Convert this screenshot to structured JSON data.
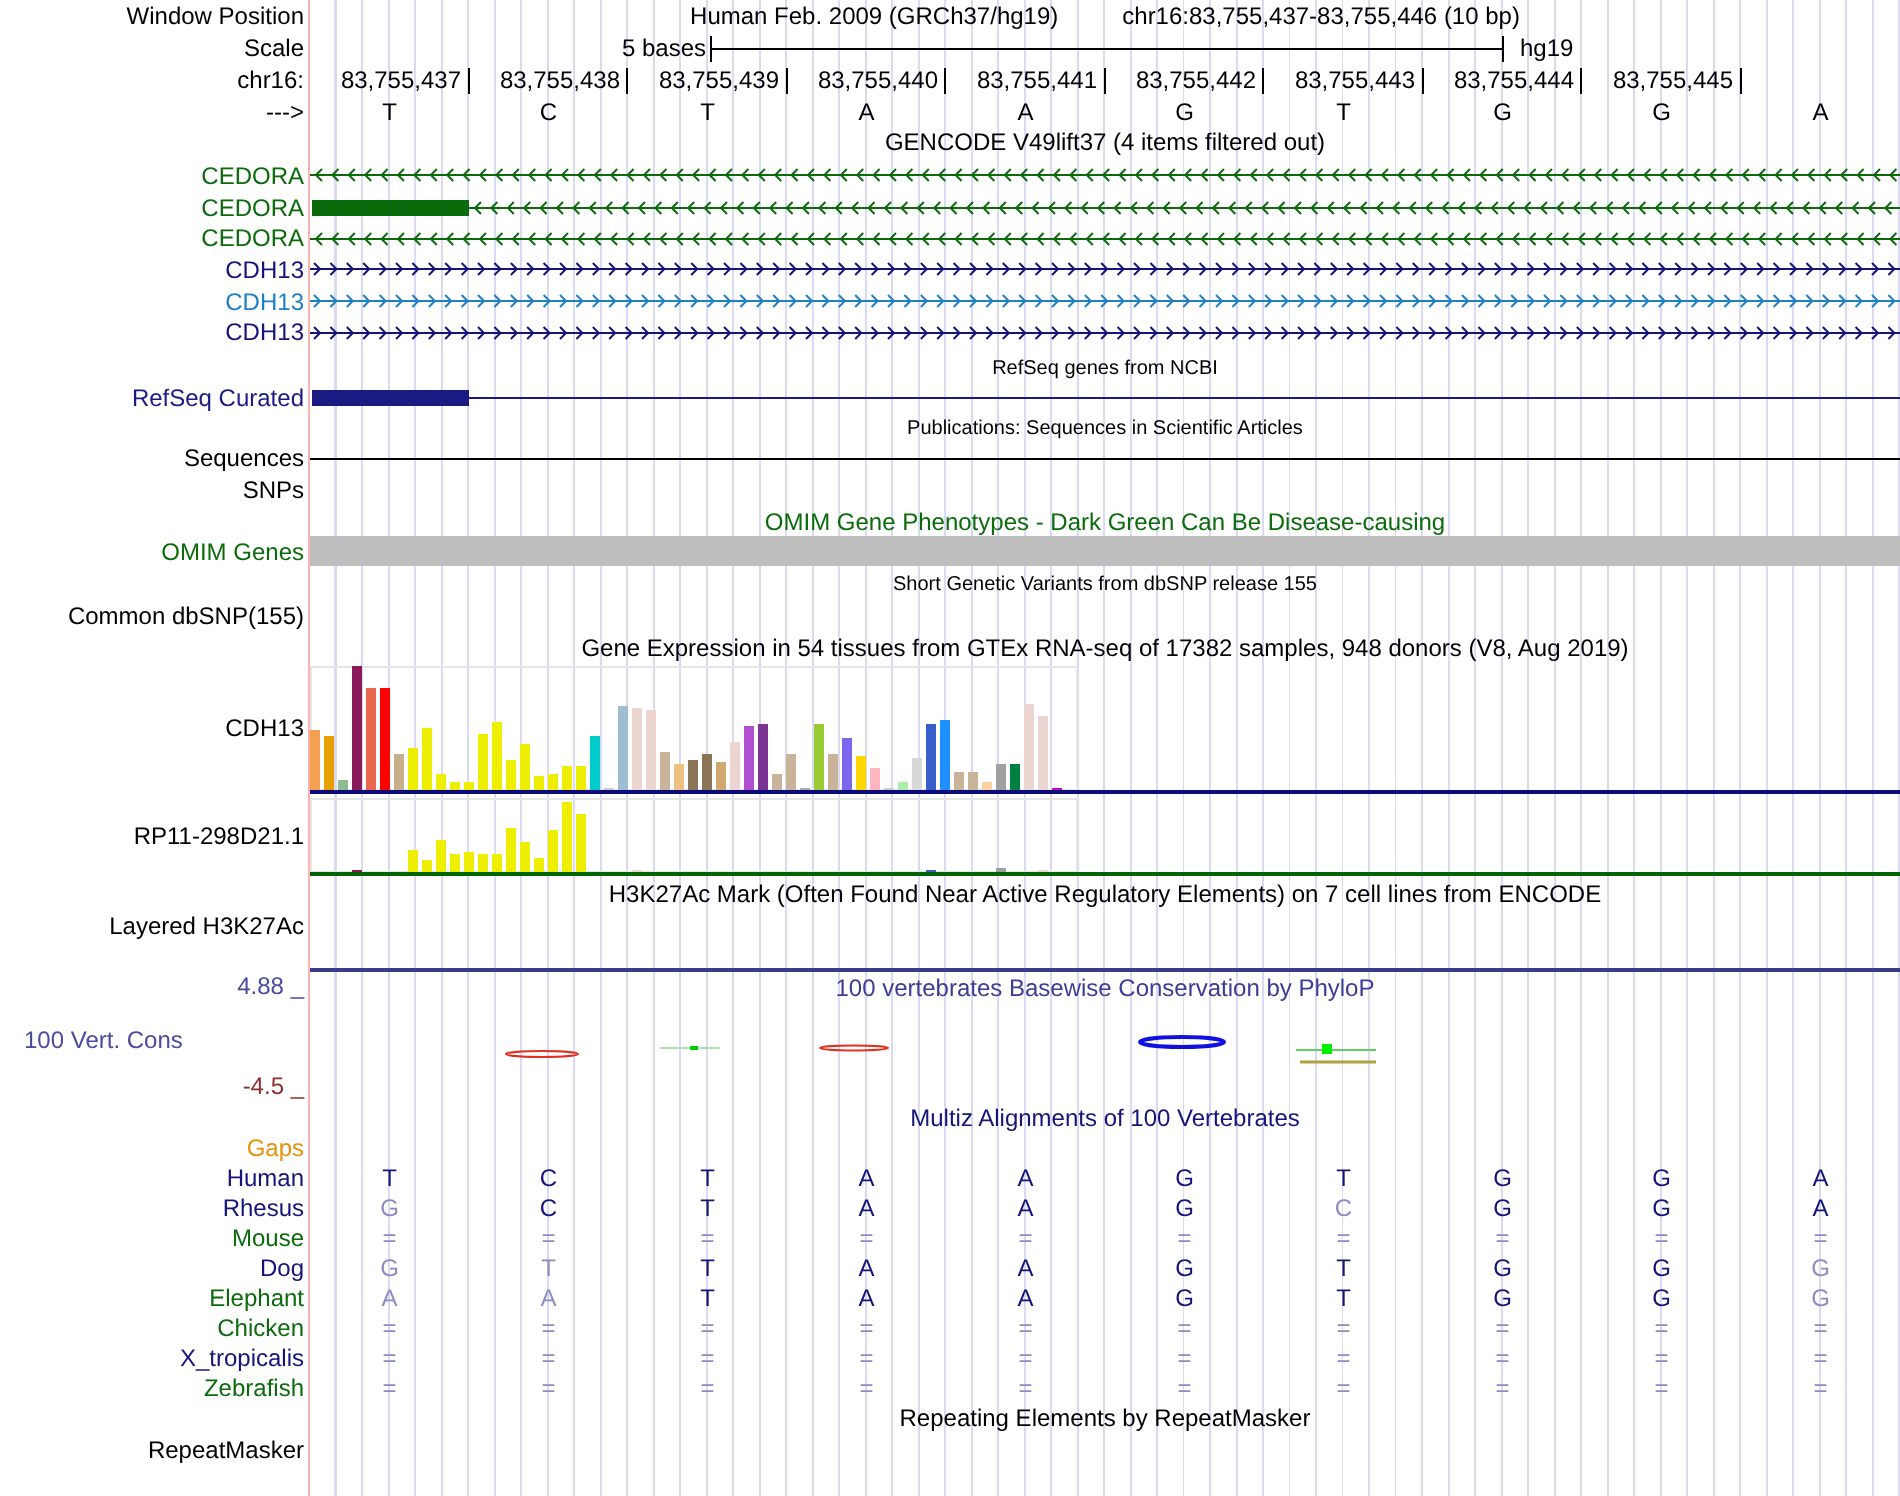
{
  "position": {
    "label": "Window Position",
    "assembly": "Human Feb. 2009 (GRCh37/hg19)",
    "range": "chr16:83,755,437-83,755,446 (10 bp)"
  },
  "scale": {
    "label": "Scale",
    "length": "5 bases",
    "assembly": "hg19"
  },
  "coordinates": {
    "label": "chr16:",
    "ticks": [
      "83,755,437",
      "83,755,438",
      "83,755,439",
      "83,755,440",
      "83,755,441",
      "83,755,442",
      "83,755,443",
      "83,755,444",
      "83,755,445"
    ]
  },
  "sequence": {
    "label": "--->",
    "bases": [
      "T",
      "C",
      "T",
      "A",
      "A",
      "G",
      "T",
      "G",
      "G",
      "A"
    ]
  },
  "tracks": [
    {
      "kind": "annotation",
      "title": "GENCODE V49lift37 (4 items filtered out)",
      "color": "#000000",
      "items": [
        {
          "kind": "gene",
          "name": "CEDORA",
          "color": "#0b6b0b",
          "strand_marks": true,
          "reverse_strand": true,
          "exon": false
        },
        {
          "kind": "gene",
          "name": "CEDORA",
          "color": "#0b6b0b",
          "strand_marks": true,
          "reverse_strand": true,
          "exon": true
        },
        {
          "kind": "gene",
          "name": "CEDORA",
          "color": "#0b6b0b",
          "strand_marks": true,
          "reverse_strand": true,
          "exon": false
        },
        {
          "kind": "gene",
          "name": "CDH13",
          "color": "#14147a",
          "strand_marks": true,
          "reverse_strand": false,
          "exon": false
        },
        {
          "kind": "gene",
          "name": "CDH13",
          "color": "#1f7fc4",
          "strand_marks": true,
          "reverse_strand": false,
          "exon": false
        },
        {
          "kind": "gene",
          "name": "CDH13",
          "color": "#14147a",
          "strand_marks": true,
          "reverse_strand": false,
          "exon": false
        }
      ]
    },
    {
      "kind": "annotation",
      "title": "RefSeq genes from NCBI",
      "color": "#000000",
      "items": [
        {
          "kind": "gene",
          "name": "RefSeq Curated",
          "color": "#1a1a82",
          "strand_marks": false,
          "exon": true
        }
      ]
    },
    {
      "kind": "annotation",
      "title": "Publications: Sequences in Scientific Articles",
      "color": "#000000",
      "items": [
        {
          "kind": "gene",
          "name": "Sequences",
          "color": "#000000",
          "strand_marks": false,
          "exon": false
        },
        {
          "kind": "empty",
          "name": "SNPs",
          "color": "#000000"
        }
      ]
    },
    {
      "kind": "annotation",
      "title": "OMIM Gene Phenotypes - Dark Green Can Be Disease-causing",
      "color": "#0b6b0b",
      "items": [
        {
          "kind": "block",
          "name": "OMIM Genes",
          "color": "#0b6b0b"
        }
      ]
    },
    {
      "kind": "annotation",
      "title": "Short Genetic Variants from dbSNP release 155",
      "color": "#000000",
      "items": [
        {
          "kind": "empty",
          "name": "Common dbSNP(155)",
          "color": "#000000"
        }
      ]
    },
    {
      "kind": "annotation",
      "title": "Gene Expression in 54 tissues from GTEx RNA-seq of 17382 samples, 948 donors (V8, Aug 2019)",
      "color": "#000000",
      "items": [
        {
          "kind": "expression",
          "name": "CDH13",
          "color": "#000000"
        },
        {
          "kind": "expression",
          "name": "RP11-298D21.1",
          "color": "#000000"
        }
      ]
    },
    {
      "kind": "annotation",
      "title": "H3K27Ac Mark (Often Found Near Active Regulatory Elements) on 7 cell lines from ENCODE",
      "color": "#000000",
      "items": [
        {
          "kind": "signal",
          "name": "Layered H3K27Ac",
          "color": "#000000"
        }
      ]
    },
    {
      "kind": "wiggle",
      "title": "100 vertebrates Basewise Conservation by PhyloP",
      "color": "#3c3c96",
      "label": "100 Vert. Cons",
      "max": "4.88 _",
      "min": "-4.5 _"
    },
    {
      "kind": "annotation",
      "title": "Multiz Alignments of 100 Vertebrates",
      "color": "#14147a",
      "items": [
        {
          "kind": "empty",
          "name": "Gaps",
          "color": "#e8900a"
        },
        {
          "kind": "bases",
          "name": "Human",
          "color": "#14147a",
          "bases": [
            {
              "text": "T",
              "conserved": true
            },
            {
              "text": "C",
              "conserved": true
            },
            {
              "text": "T",
              "conserved": true
            },
            {
              "text": "A",
              "conserved": true
            },
            {
              "text": "A",
              "conserved": true
            },
            {
              "text": "G",
              "conserved": true
            },
            {
              "text": "T",
              "conserved": true
            },
            {
              "text": "G",
              "conserved": true
            },
            {
              "text": "G",
              "conserved": true
            },
            {
              "text": "A",
              "conserved": true
            }
          ]
        },
        {
          "kind": "bases",
          "name": "Rhesus",
          "color": "#14147a",
          "bases": [
            {
              "text": "G",
              "conserved": false
            },
            {
              "text": "C",
              "conserved": true
            },
            {
              "text": "T",
              "conserved": true
            },
            {
              "text": "A",
              "conserved": true
            },
            {
              "text": "A",
              "conserved": true
            },
            {
              "text": "G",
              "conserved": true
            },
            {
              "text": "C",
              "conserved": false
            },
            {
              "text": "G",
              "conserved": true
            },
            {
              "text": "G",
              "conserved": true
            },
            {
              "text": "A",
              "conserved": true
            }
          ]
        },
        {
          "kind": "bases",
          "name": "Mouse",
          "color": "#0b6b0b",
          "bases": [
            {
              "text": "=",
              "conserved": false
            },
            {
              "text": "=",
              "conserved": false
            },
            {
              "text": "=",
              "conserved": false
            },
            {
              "text": "=",
              "conserved": false
            },
            {
              "text": "=",
              "conserved": false
            },
            {
              "text": "=",
              "conserved": false
            },
            {
              "text": "=",
              "conserved": false
            },
            {
              "text": "=",
              "conserved": false
            },
            {
              "text": "=",
              "conserved": false
            },
            {
              "text": "=",
              "conserved": false
            }
          ]
        },
        {
          "kind": "bases",
          "name": "Dog",
          "color": "#14147a",
          "bases": [
            {
              "text": "G",
              "conserved": false
            },
            {
              "text": "T",
              "conserved": false
            },
            {
              "text": "T",
              "conserved": true
            },
            {
              "text": "A",
              "conserved": true
            },
            {
              "text": "A",
              "conserved": true
            },
            {
              "text": "G",
              "conserved": true
            },
            {
              "text": "T",
              "conserved": true
            },
            {
              "text": "G",
              "conserved": true
            },
            {
              "text": "G",
              "conserved": true
            },
            {
              "text": "G",
              "conserved": false
            }
          ]
        },
        {
          "kind": "bases",
          "name": "Elephant",
          "color": "#0b6b0b",
          "bases": [
            {
              "text": "A",
              "conserved": false
            },
            {
              "text": "A",
              "conserved": false
            },
            {
              "text": "T",
              "conserved": true
            },
            {
              "text": "A",
              "conserved": true
            },
            {
              "text": "A",
              "conserved": true
            },
            {
              "text": "G",
              "conserved": true
            },
            {
              "text": "T",
              "conserved": true
            },
            {
              "text": "G",
              "conserved": true
            },
            {
              "text": "G",
              "conserved": true
            },
            {
              "text": "G",
              "conserved": false
            }
          ]
        },
        {
          "kind": "bases",
          "name": "Chicken",
          "color": "#0b6b0b",
          "bases": [
            {
              "text": "=",
              "conserved": false
            },
            {
              "text": "=",
              "conserved": false
            },
            {
              "text": "=",
              "conserved": false
            },
            {
              "text": "=",
              "conserved": false
            },
            {
              "text": "=",
              "conserved": false
            },
            {
              "text": "=",
              "conserved": false
            },
            {
              "text": "=",
              "conserved": false
            },
            {
              "text": "=",
              "conserved": false
            },
            {
              "text": "=",
              "conserved": false
            },
            {
              "text": "=",
              "conserved": false
            }
          ]
        },
        {
          "kind": "bases",
          "name": "X_tropicalis",
          "color": "#14147a",
          "bases": [
            {
              "text": "=",
              "conserved": false
            },
            {
              "text": "=",
              "conserved": false
            },
            {
              "text": "=",
              "conserved": false
            },
            {
              "text": "=",
              "conserved": false
            },
            {
              "text": "=",
              "conserved": false
            },
            {
              "text": "=",
              "conserved": false
            },
            {
              "text": "=",
              "conserved": false
            },
            {
              "text": "=",
              "conserved": false
            },
            {
              "text": "=",
              "conserved": false
            },
            {
              "text": "=",
              "conserved": false
            }
          ]
        },
        {
          "kind": "bases",
          "name": "Zebrafish",
          "color": "#0b6b0b",
          "bases": [
            {
              "text": "=",
              "conserved": false
            },
            {
              "text": "=",
              "conserved": false
            },
            {
              "text": "=",
              "conserved": false
            },
            {
              "text": "=",
              "conserved": false
            },
            {
              "text": "=",
              "conserved": false
            },
            {
              "text": "=",
              "conserved": false
            },
            {
              "text": "=",
              "conserved": false
            },
            {
              "text": "=",
              "conserved": false
            },
            {
              "text": "=",
              "conserved": false
            },
            {
              "text": "=",
              "conserved": false
            }
          ]
        }
      ]
    },
    {
      "kind": "annotation",
      "title": "Repeating Elements by RepeatMasker",
      "color": "#000000",
      "items": [
        {
          "kind": "empty",
          "name": "RepeatMasker",
          "color": "#000000"
        }
      ]
    }
  ]
}
